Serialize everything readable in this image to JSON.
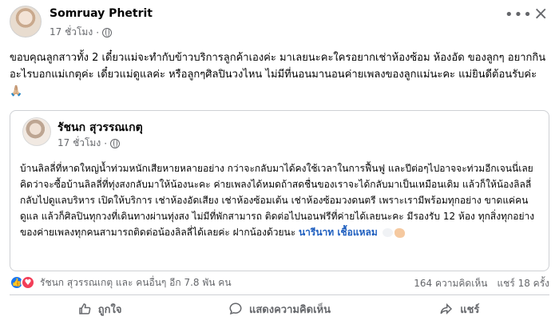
{
  "post": {
    "author": "Somruay Phetrit",
    "time": "17 ชั่วโมง",
    "text": "ขอบคุณลูกสาวทั้ง 2 เดี๋ยวแม่จะทำกับข้าวบริการลูกค้าเองค่ะ มาเลยนะคะใครอยากเช่าห้องซ้อม ห้องอัด ของลูกๆ อยากกินอะไรบอกแม่เกตุค่ะ เดี๋ยวแม่ดูแลค่ะ หรือลูกๆศิลปินวงไหน ไม่มีที่นอนมานอนค่ายเพลงของลูกแม่นะคะ แม่ยินดีต้อนรับค่ะ 🙏🏼"
  },
  "shared": {
    "author": "รัชนก สุวรรณเกตุ",
    "time": "17 ชั่วโมง",
    "text": "บ้านลิลลี่ที่หาดใหญ่น้ำท่วมหนักเสียหายหลายอย่าง กว่าจะกลับมาได้คงใช้เวลาในการฟื้นฟู และปีต่อๆไปอาจจะท่วมอีกเจนนี่เลยคิดว่าจะซื้อบ้านลิลลี่ที่ทุ่งสงกลับมาให้น้องนะคะ ค่ายเพลงได้หมดถ้าสดชื่นของเราจะได้กลับมาเป็นเหมือนเดิม แล้วก็ให้น้องลิลลี่กลับไปดูแลบริหาร เปิดให้บริการ เช่าห้องอัดเสียง เช่าห้องซ้อมเต้น เช่าห้องซ้อมวงดนตรี เพราะเรามีพร้อมทุกอย่าง ขาดแค่คนดูแล แล้วก็ศิลปินทุกวงที่เดินทางผ่านทุ่งสง ไม่มีที่พักสามารถ ติดต่อไปนอนฟรีที่ค่ายได้เลยนะคะ มีรองรับ 12 ห้อง ทุกสิ่งทุกอย่างของค่ายเพลงทุกคนสามารถติดต่อน้องลิลลี่ได้เลยค่ะ ฝากน้องด้วยนะ ",
    "mention": "นารีนาท เชื้อแหลม"
  },
  "reactions": {
    "names": "รัชนก สุวรรณเกตุ และ คนอื่นๆ อีก 7.8 พัน คน",
    "comments": "164 ความคิดเห็น",
    "shares": "แชร์ 18 ครั้ง"
  },
  "actions": {
    "like": "ถูกใจ",
    "comment": "แสดงความคิดเห็น",
    "share": "แชร์"
  },
  "icons": {
    "more": "more-dots-icon",
    "close": "close-icon",
    "privacy": "globe-icon",
    "like": "thumbs-up-icon",
    "comment": "comment-bubble-icon",
    "share": "share-arrow-icon"
  },
  "colors": {
    "like_blue": "#1877f2",
    "love_red": "#f33e58",
    "mention_blue": "#1f5fbf",
    "secondary_text": "#65676b"
  }
}
